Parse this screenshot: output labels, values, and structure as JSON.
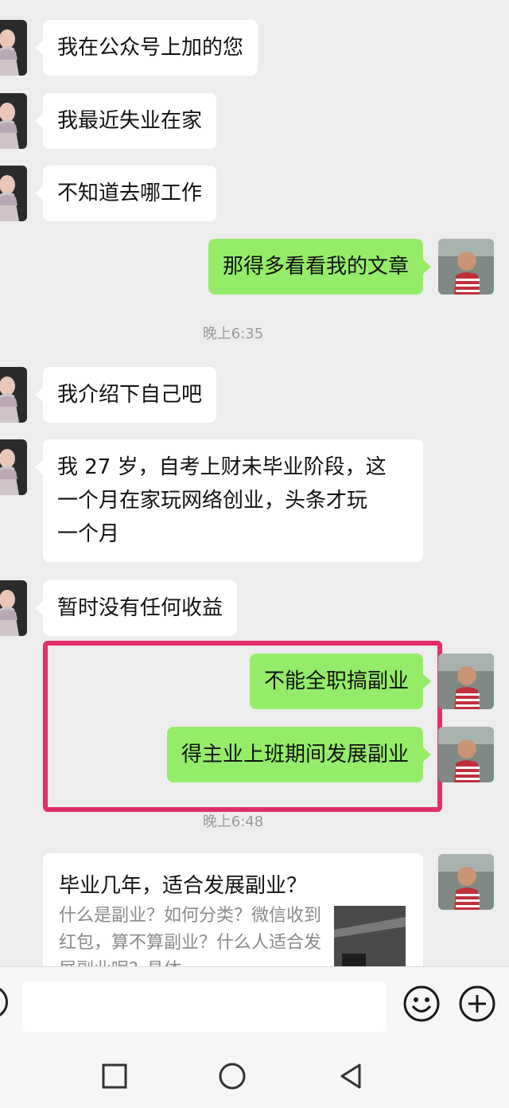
{
  "messages": [
    {
      "side": "in",
      "text": "我在公众号上加的您"
    },
    {
      "side": "in",
      "text": "我最近失业在家"
    },
    {
      "side": "in",
      "text": "不知道去哪工作"
    },
    {
      "side": "out",
      "text": "那得多看看我的文章"
    },
    {
      "side": "in",
      "text": "我介绍下自己吧"
    },
    {
      "side": "in",
      "lines": [
        "我 27 岁，自考上财未毕业阶段，这",
        "一个月在家玩网络创业，头条才玩",
        "一个月"
      ]
    },
    {
      "side": "in",
      "text": "暂时没有任何收益"
    },
    {
      "side": "out",
      "text": "不能全职搞副业"
    },
    {
      "side": "out",
      "text": "得主业上班期间发展副业"
    }
  ],
  "timestamps": [
    "晚上6:35",
    "晚上6:48"
  ],
  "article_card": {
    "title": "毕业几年，适合发展副业？",
    "description": "什么是副业？如何分类？微信收到红包，算不算副业？什么人适合发展副业呢？具体"
  },
  "colors": {
    "incoming_bubble": "#ffffff",
    "outgoing_bubble": "#95ec69",
    "highlight_border": "#e12e6b",
    "background": "#ededed"
  },
  "icons": [
    "voice-icon",
    "emoji-icon",
    "plus-icon",
    "back-nav-icon",
    "home-nav-icon",
    "recent-apps-nav-icon"
  ]
}
